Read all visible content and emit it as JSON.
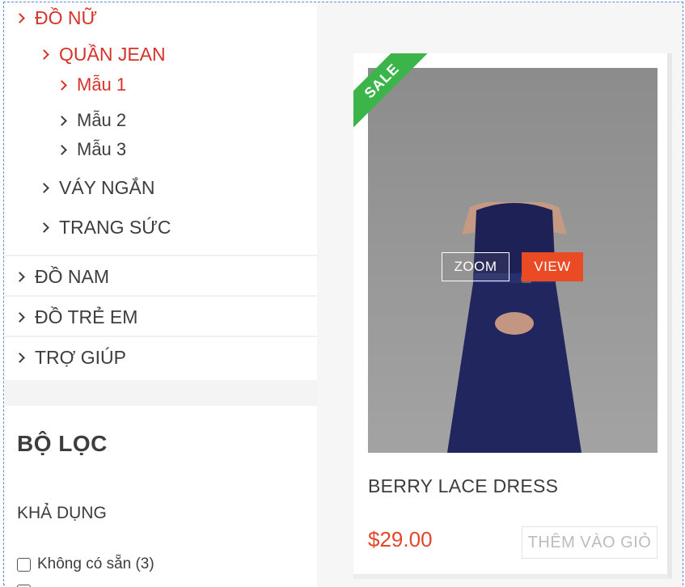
{
  "menu": {
    "items": [
      {
        "label": "ĐỒ NỮ",
        "level": 1,
        "active": true
      },
      {
        "label": "QUẦN JEAN",
        "level": 2,
        "active": true
      },
      {
        "label": "Mẫu 1",
        "level": 3,
        "active": true
      },
      {
        "label": "Mẫu 2",
        "level": 3,
        "active": false
      },
      {
        "label": "Mẫu 3",
        "level": 3,
        "active": false
      },
      {
        "label": "VÁY NGẮN",
        "level": 2,
        "active": false
      },
      {
        "label": "TRANG SỨC",
        "level": 2,
        "active": false
      },
      {
        "label": "ĐỒ NAM",
        "level": 1,
        "active": false
      },
      {
        "label": "ĐỒ TRẺ EM",
        "level": 1,
        "active": false
      },
      {
        "label": "TRỢ GIÚP",
        "level": 1,
        "active": false
      }
    ]
  },
  "filter": {
    "title": "BỘ LỌC",
    "availability_title": "KHẢ DỤNG",
    "options": [
      {
        "label": "Không có sẵn (3)",
        "checked": false
      }
    ]
  },
  "product": {
    "badge": "SALE",
    "zoom_label": "ZOOM",
    "view_label": "VIEW",
    "name": "BERRY LACE DRESS",
    "price": "$29.00",
    "add_to_cart_label": "THÊM VÀO GIỎ"
  },
  "colors": {
    "accent": "#d7322a",
    "sale_green": "#3bb54a",
    "view_orange": "#ea4b24",
    "price": "#e2472c"
  }
}
